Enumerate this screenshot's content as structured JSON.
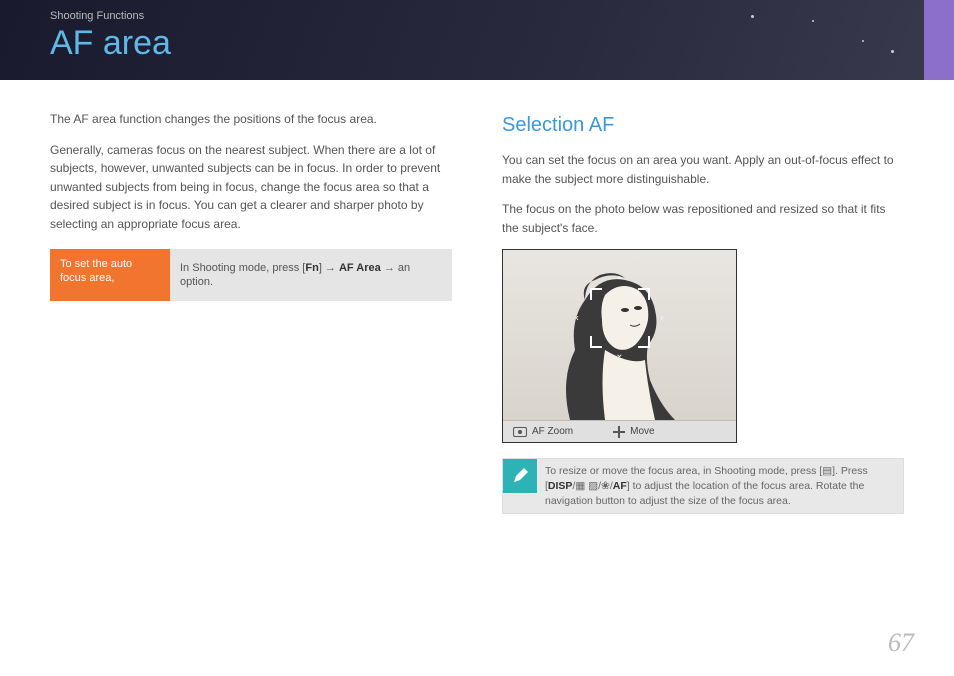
{
  "header": {
    "breadcrumb": "Shooting Functions",
    "title": "AF area"
  },
  "left": {
    "intro": "The AF area function changes the positions of the focus area.",
    "body": "Generally, cameras focus on the nearest subject. When there are a lot of subjects, however, unwanted subjects can be in focus. In order to prevent unwanted subjects from being in focus, change the focus area so that a desired subject is in focus. You can get a clearer and sharper photo by selecting an appropriate focus area.",
    "action_label": "To set the auto focus area,",
    "action_prefix": "In Shooting mode, press [",
    "action_fn": "Fn",
    "action_mid": "] → ",
    "action_bold": "AF Area",
    "action_suffix": " → an option."
  },
  "right": {
    "title": "Selection AF",
    "p1": "You can set the focus on an area you want. Apply an out-of-focus effect to make the subject more distinguishable.",
    "p2": "The focus on the photo below was repositioned and resized so that it fits the subject's face.",
    "af_zoom": "AF Zoom",
    "move": "Move",
    "tip_prefix": "To resize or move the focus area, in Shooting mode, press [",
    "tip_icon1": "▤",
    "tip_mid1": "]. Press [",
    "tip_disp": "DISP",
    "tip_slash1": "/",
    "tip_grid": "▦",
    "tip_slash2": " ▨/",
    "tip_flower": "❀/",
    "tip_af": "AF",
    "tip_suffix": "] to adjust the location of the focus area. Rotate the navigation button to adjust the size of the focus area."
  },
  "page_number": "67"
}
